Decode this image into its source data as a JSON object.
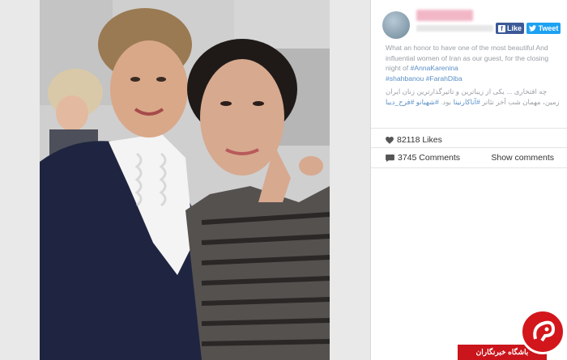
{
  "post": {
    "caption_en_1": "What an honor to have one of the most beautiful And influential women of Iran as our guest, for the closing night of ",
    "caption_tag_1": "#AnnaKarenina",
    "caption_tag_2": "#shahbanou",
    "caption_tag_3": "#FarahDiba",
    "caption_fa_1": "چه افتخاری ... یکی از زیباترین و تاثیرگذارترین زنان ایران زمین، مهمان شب آخر تئاتر ",
    "caption_fa_tag_1": "#آناکارنینا",
    "caption_fa_mid": " بود. ",
    "caption_fa_tag_2": "#شهبانو",
    "caption_fa_tag_3": "#فرح_دیبا"
  },
  "social": {
    "like_label": "Like",
    "tweet_label": "Tweet"
  },
  "stats": {
    "likes": "82118 Likes",
    "comments": "3745 Comments",
    "show_comments": "Show comments"
  },
  "watermark": {
    "label": "باشگاه خبرنگاران"
  },
  "colors": {
    "accent_blue": "#3b5998",
    "twitter_blue": "#1da1f2",
    "hashtag": "#5a8fc7",
    "brand_red": "#c9151b"
  }
}
